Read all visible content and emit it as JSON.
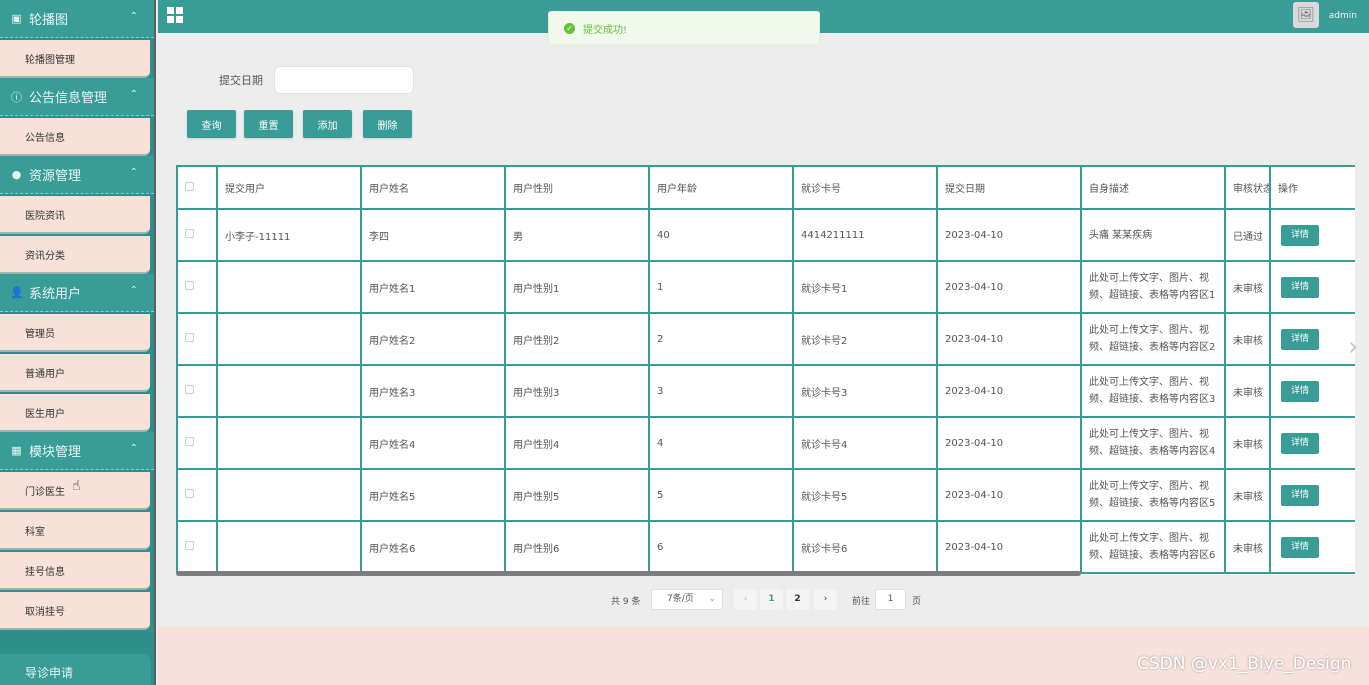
{
  "sidebar": {
    "groups": [
      {
        "title": "轮播图",
        "icon": "image-icon",
        "items": [
          "轮播图管理"
        ]
      },
      {
        "title": "公告信息管理",
        "icon": "info-icon",
        "items": [
          "公告信息"
        ]
      },
      {
        "title": "资源管理",
        "icon": "location-icon",
        "items": [
          "医院资讯",
          "资讯分类"
        ]
      },
      {
        "title": "系统用户",
        "icon": "user-icon",
        "items": [
          "管理员",
          "普通用户",
          "医生用户"
        ]
      },
      {
        "title": "模块管理",
        "icon": "grid-icon",
        "items": [
          "门诊医生",
          "科室",
          "挂号信息",
          "取消挂号"
        ]
      }
    ],
    "bottom_item": "导诊申请"
  },
  "header": {
    "title": "",
    "username": "admin"
  },
  "toast": {
    "message": "提交成功!"
  },
  "filter": {
    "label": "提交日期",
    "value": ""
  },
  "buttons": {
    "search": "查询",
    "reset": "重置",
    "add": "添加",
    "delete": "删除"
  },
  "table": {
    "columns": [
      "提交用户",
      "用户姓名",
      "用户性别",
      "用户年龄",
      "就诊卡号",
      "提交日期",
      "自身描述",
      "审核状态",
      "操作"
    ],
    "detail_label": "详情",
    "rows": [
      {
        "user": "小李子-11111",
        "name": "李四",
        "gender": "男",
        "age": "40",
        "card": "4414211111",
        "date": "2023-04-10",
        "desc": "头痛 某某疾病",
        "status": "已通过"
      },
      {
        "user": "",
        "name": "用户姓名1",
        "gender": "用户性别1",
        "age": "1",
        "card": "就诊卡号1",
        "date": "2023-04-10",
        "desc": "此处可上传文字、图片、视频、超链接、表格等内容区1",
        "status": "未审核"
      },
      {
        "user": "",
        "name": "用户姓名2",
        "gender": "用户性别2",
        "age": "2",
        "card": "就诊卡号2",
        "date": "2023-04-10",
        "desc": "此处可上传文字、图片、视频、超链接、表格等内容区2",
        "status": "未审核"
      },
      {
        "user": "",
        "name": "用户姓名3",
        "gender": "用户性别3",
        "age": "3",
        "card": "就诊卡号3",
        "date": "2023-04-10",
        "desc": "此处可上传文字、图片、视频、超链接、表格等内容区3",
        "status": "未审核"
      },
      {
        "user": "",
        "name": "用户姓名4",
        "gender": "用户性别4",
        "age": "4",
        "card": "就诊卡号4",
        "date": "2023-04-10",
        "desc": "此处可上传文字、图片、视频、超链接、表格等内容区4",
        "status": "未审核"
      },
      {
        "user": "",
        "name": "用户姓名5",
        "gender": "用户性别5",
        "age": "5",
        "card": "就诊卡号5",
        "date": "2023-04-10",
        "desc": "此处可上传文字、图片、视频、超链接、表格等内容区5",
        "status": "未审核"
      },
      {
        "user": "",
        "name": "用户姓名6",
        "gender": "用户性别6",
        "age": "6",
        "card": "就诊卡号6",
        "date": "2023-04-10",
        "desc": "此处可上传文字、图片、视频、超链接、表格等内容区6",
        "status": "未审核"
      }
    ]
  },
  "pagination": {
    "total": "共 9 条",
    "page_size": "7条/页",
    "pages": [
      "1",
      "2"
    ],
    "current": "1",
    "goto_label": "前往",
    "goto_value": "1",
    "page_suffix": "页"
  },
  "watermark": "CSDN @vx1_Biye_Design",
  "colors": {
    "primary": "#3a9c96",
    "submenu_bg": "#f7e1d8",
    "success": "#67c23a"
  }
}
